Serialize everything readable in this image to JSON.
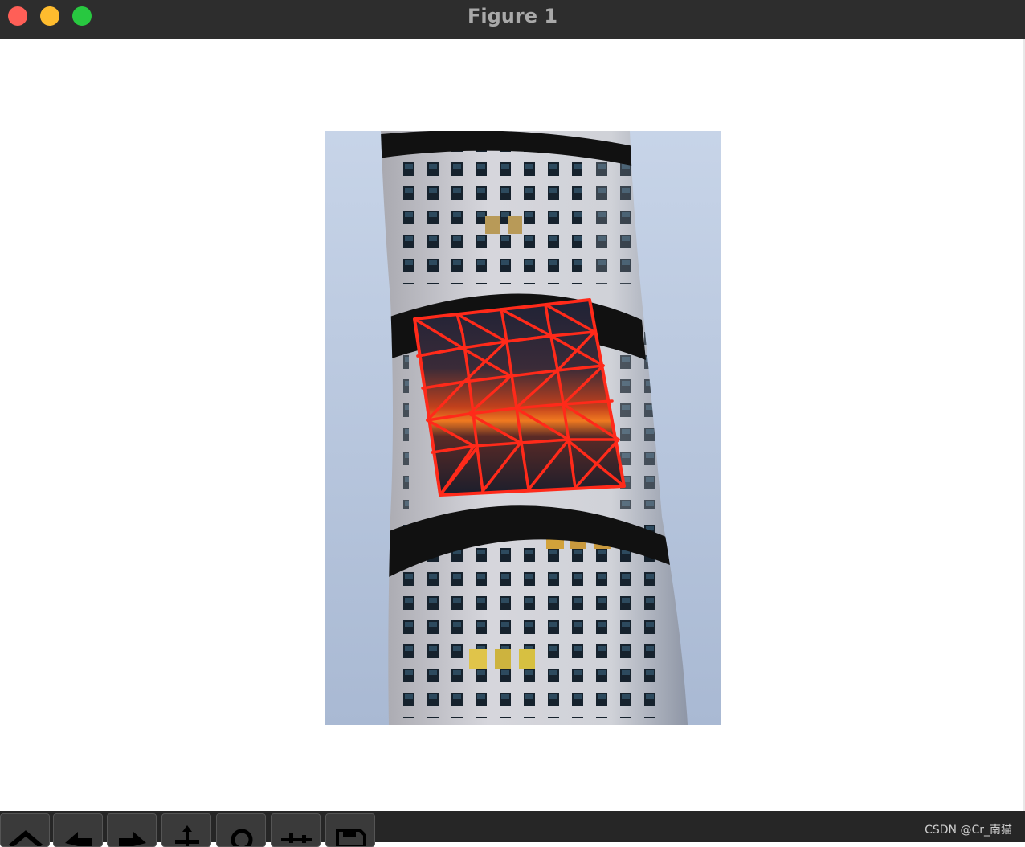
{
  "window": {
    "title": "Figure 1"
  },
  "toolbar": {
    "buttons": [
      {
        "name": "home",
        "icon": "home-icon"
      },
      {
        "name": "back",
        "icon": "arrow-left-icon"
      },
      {
        "name": "forward",
        "icon": "arrow-right-icon"
      },
      {
        "name": "pan",
        "icon": "move-icon"
      },
      {
        "name": "zoom",
        "icon": "zoom-icon"
      },
      {
        "name": "configure",
        "icon": "sliders-icon"
      },
      {
        "name": "save",
        "icon": "save-icon"
      }
    ]
  },
  "watermark": "CSDN @Cr_南猫",
  "colors": {
    "mesh": "#ff2a1a",
    "titlebar": "#2d2d2d",
    "toolbar": "#262626"
  }
}
